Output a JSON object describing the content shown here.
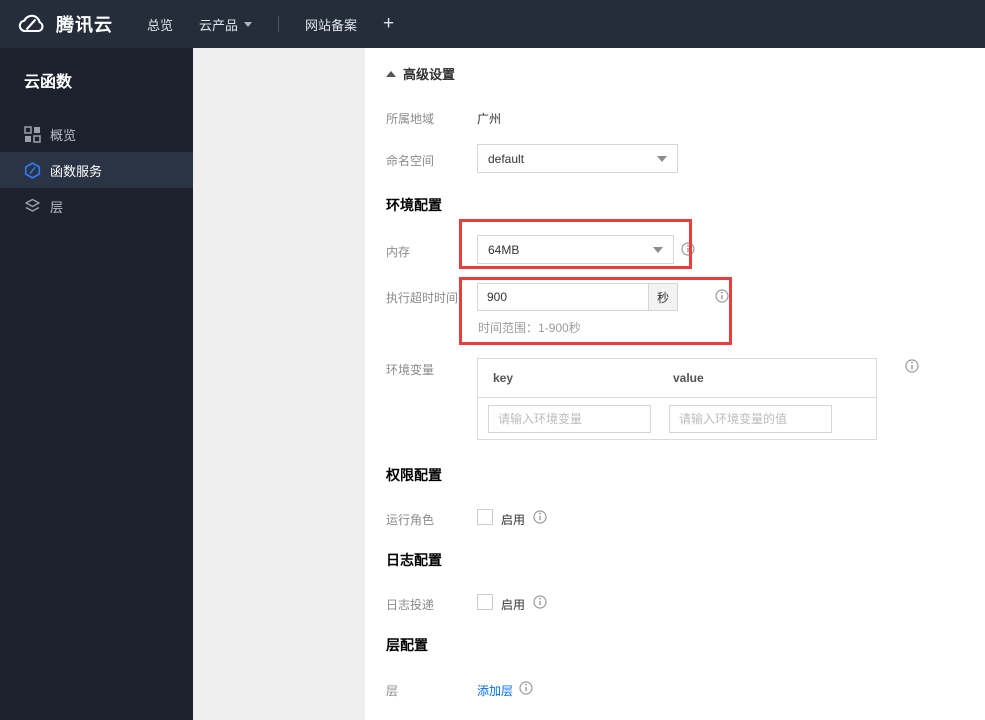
{
  "navbar": {
    "brand": "腾讯云",
    "overview": "总览",
    "products": "云产品",
    "icp": "网站备案",
    "plus": "+"
  },
  "sidebar": {
    "title": "云函数",
    "items": [
      {
        "label": "概览",
        "icon": "grid-icon"
      },
      {
        "label": "函数服务",
        "icon": "function-hexagon-icon"
      },
      {
        "label": "层",
        "icon": "layers-icon"
      }
    ]
  },
  "main": {
    "advanced_settings": "高级设置",
    "region_label": "所属地域",
    "region_value": "广州",
    "namespace_label": "命名空间",
    "namespace_value": "default",
    "env_config_title": "环境配置",
    "memory_label": "内存",
    "memory_value": "64MB",
    "timeout_label": "执行超时时间",
    "timeout_value": "900",
    "timeout_unit": "秒",
    "timeout_hint": "时间范围：1-900秒",
    "envvar_label": "环境变量",
    "envvar_key_header": "key",
    "envvar_value_header": "value",
    "envvar_key_placeholder": "请输入环境变量",
    "envvar_value_placeholder": "请输入环境变量的值",
    "perm_config_title": "权限配置",
    "run_role_label": "运行角色",
    "run_role_enable": "启用",
    "log_config_title": "日志配置",
    "log_delivery_label": "日志投递",
    "log_delivery_enable": "启用",
    "layer_config_title": "层配置",
    "layer_label": "层",
    "add_layer_link": "添加层"
  },
  "colors": {
    "navbar_bg": "#252d3b",
    "sidebar_bg": "#1c222d",
    "sidebar_active_bg": "#2b3444",
    "accent_blue": "#006eff",
    "function_icon_blue": "#2f7cff",
    "highlight_red": "#e83e3e",
    "panel_gray": "#efefef"
  }
}
